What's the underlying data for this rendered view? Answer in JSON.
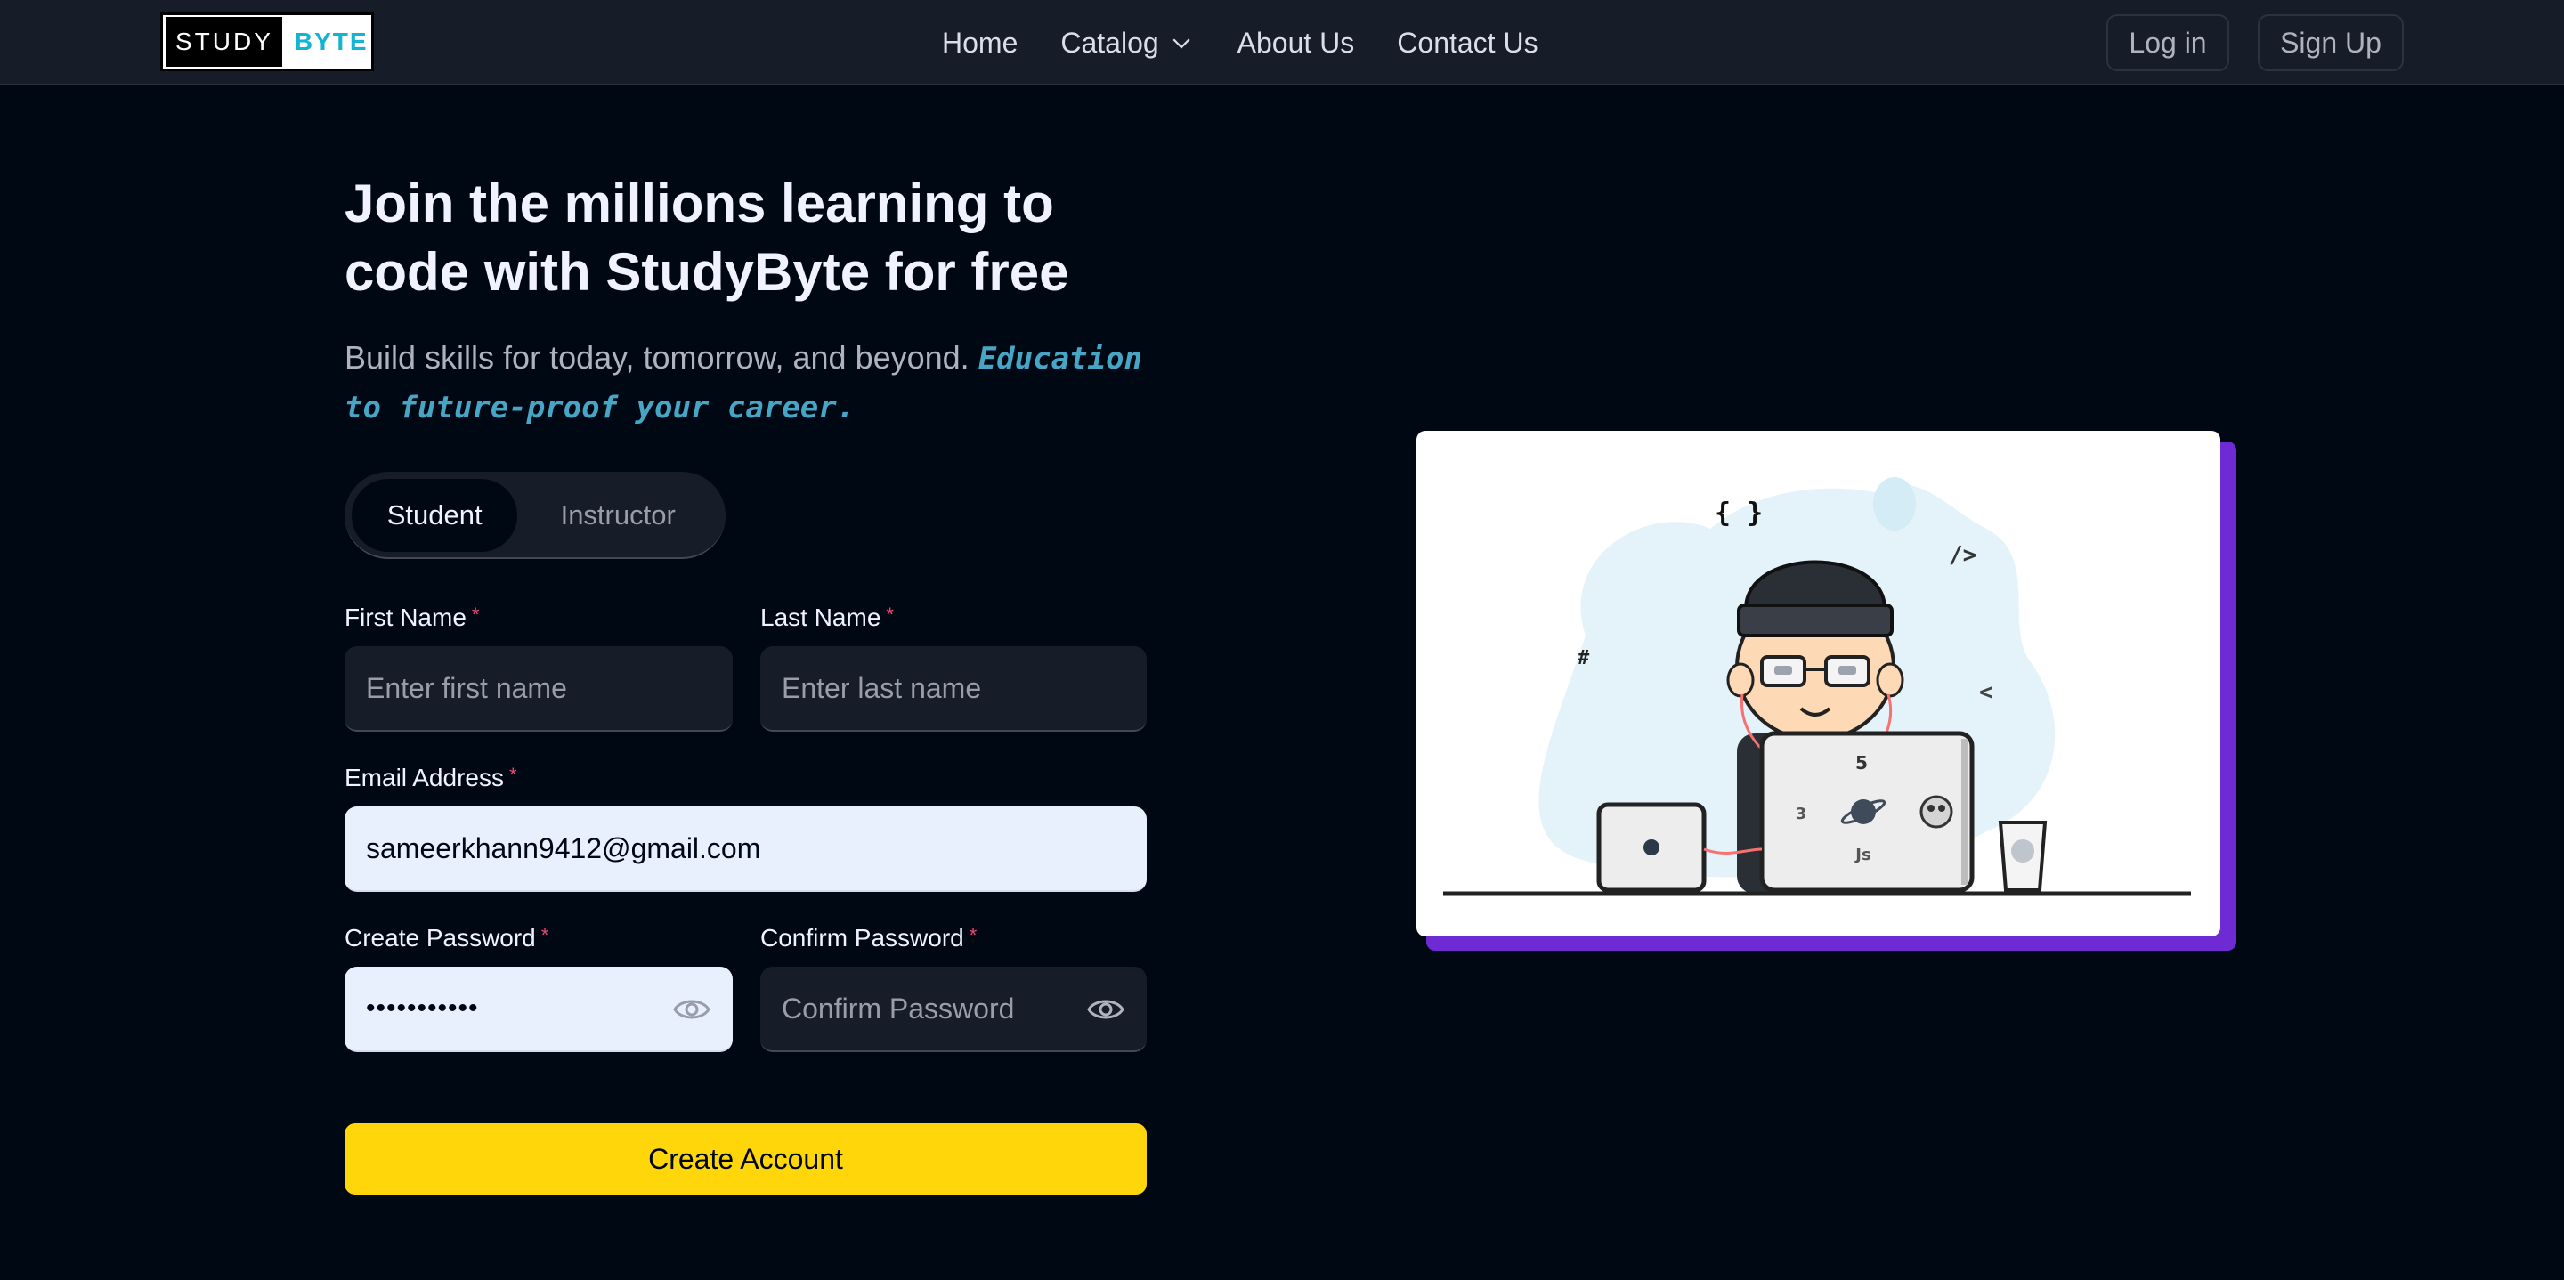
{
  "nav": {
    "logo_part1": "STUDY",
    "logo_part2": "BYTE",
    "links": [
      {
        "label": "Home"
      },
      {
        "label": "Catalog"
      },
      {
        "label": "About Us"
      },
      {
        "label": "Contact Us"
      }
    ],
    "login_label": "Log in",
    "signup_label": "Sign Up"
  },
  "hero": {
    "title": "Join the millions learning to code with StudyByte for free",
    "subtitle": "Build skills for today, tomorrow, and beyond.",
    "subtitle_accent": "Education to future-proof your career."
  },
  "role_toggle": {
    "options": [
      "Student",
      "Instructor"
    ],
    "selected": "Student"
  },
  "form": {
    "first_name": {
      "label": "First Name",
      "placeholder": "Enter first name",
      "value": ""
    },
    "last_name": {
      "label": "Last Name",
      "placeholder": "Enter last name",
      "value": ""
    },
    "email": {
      "label": "Email Address",
      "value": "sameerkhann9412@gmail.com"
    },
    "password": {
      "label": "Create Password",
      "value": "•••••••••••"
    },
    "confirm_password": {
      "label": "Confirm Password",
      "placeholder": "Confirm Password",
      "value": ""
    },
    "required_mark": "*",
    "submit_label": "Create Account"
  },
  "illustration": {
    "code_symbols": [
      "{ }",
      "/>",
      "#",
      "<",
      "5",
      "3",
      "Js"
    ]
  },
  "colors": {
    "page_bg": "#000814",
    "nav_bg": "#161D29",
    "field_bg": "#161D29",
    "accent_yellow": "#FFD60A",
    "accent_blue": "#47A5C5",
    "frame_shadow": "#6E2AD3",
    "required_red": "#EF476F"
  }
}
